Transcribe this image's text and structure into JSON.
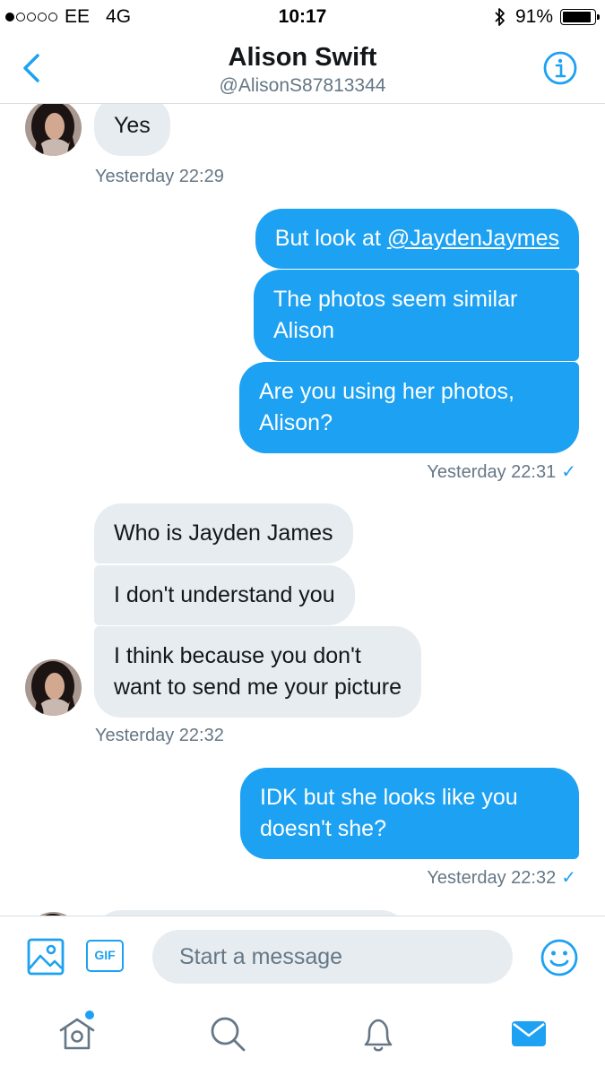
{
  "status_bar": {
    "carrier": "EE",
    "network": "4G",
    "time": "10:17",
    "battery": "91%",
    "signal_bars": 1,
    "signal_total": 5
  },
  "header": {
    "name": "Alison Swift",
    "handle": "@AlisonS87813344",
    "back_icon": "chevron-left-icon",
    "info_icon": "info-circle-icon"
  },
  "conversation": {
    "messages": [
      {
        "side": "in",
        "text": "Yes"
      },
      {
        "side": "out",
        "text_prefix": "But look at ",
        "mention": "@JaydenJaymes"
      },
      {
        "side": "out",
        "lines": [
          "The photos seem similar",
          "Alison"
        ]
      },
      {
        "side": "out",
        "lines": [
          "Are you using her photos,",
          "Alison?"
        ]
      },
      {
        "side": "in",
        "text": "Who is Jayden James"
      },
      {
        "side": "in",
        "text": "I don't understand you"
      },
      {
        "side": "in",
        "lines": [
          "I think because you don't",
          "want to send me your picture"
        ]
      },
      {
        "side": "out",
        "lines": [
          "IDK but she looks like you",
          "doesn't she?"
        ]
      }
    ],
    "timestamps": {
      "t1": "Yesterday 22:29",
      "t2": "Yesterday 22:31",
      "t3": "Yesterday 22:32",
      "t4": "Yesterday 22:32"
    },
    "read_mark": "✓"
  },
  "composer": {
    "placeholder": "Start a message",
    "gif_label": "GIF"
  },
  "tabbar": {
    "items": [
      "home-icon",
      "search-icon",
      "bell-icon",
      "envelope-icon"
    ]
  },
  "colors": {
    "accent": "#1da1f2",
    "incoming_bubble": "#e6ecf0",
    "secondary_text": "#657786"
  }
}
